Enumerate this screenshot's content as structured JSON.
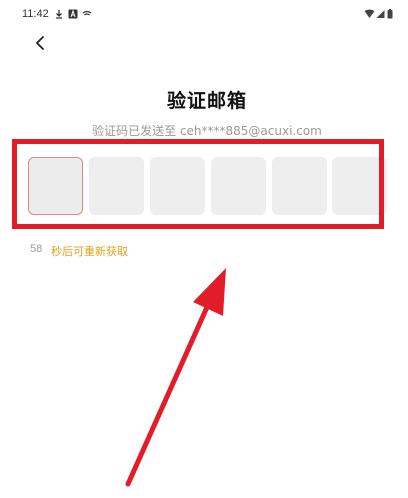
{
  "status_bar": {
    "time": "11:42",
    "icons_left": [
      "download-icon",
      "a-badge-icon",
      "wifi-small-icon"
    ],
    "icons_right": [
      "wifi-icon",
      "signal-icon",
      "battery-icon"
    ]
  },
  "header": {
    "back_icon": "chevron-left-icon"
  },
  "main": {
    "title": "验证邮箱",
    "subtitle": "验证码已发送至 ceh****885@acuxi.com",
    "code_cells": [
      "",
      "",
      "",
      "",
      "",
      ""
    ],
    "countdown": "58",
    "resend_label": "秒后可重新获取"
  },
  "colors": {
    "highlight": "#e21d2a",
    "accent": "#e6a11a",
    "active_border": "#e8877b"
  }
}
